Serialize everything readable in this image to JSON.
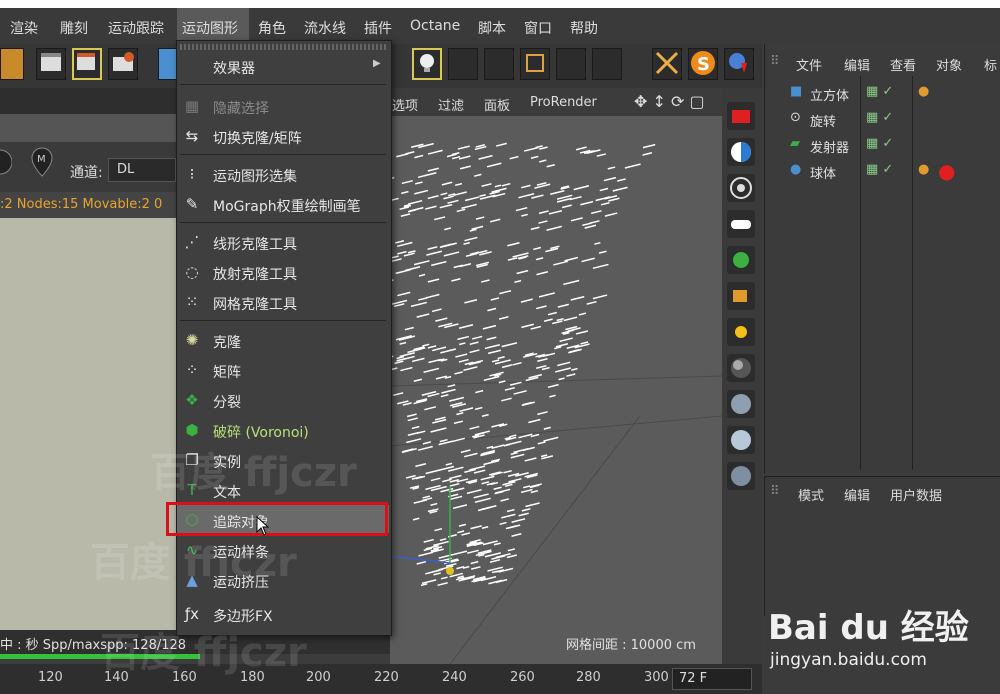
{
  "menubar": {
    "items": [
      "渲染",
      "雕刻",
      "运动跟踪",
      "运动图形",
      "角色",
      "流水线",
      "插件",
      "Octane",
      "脚本",
      "窗口",
      "帮助"
    ]
  },
  "leftpanel": {
    "channel_label": "通道:",
    "channel_value": "DL",
    "info_text": ":2 Nodes:15 Movable:2  0"
  },
  "viewport": {
    "menus": [
      "选项",
      "过滤",
      "面板",
      "ProRender"
    ],
    "grid_readout": "网格间距 : 10000 cm"
  },
  "object_manager": {
    "menus": [
      "文件",
      "编辑",
      "查看",
      "对象",
      "标"
    ],
    "objects": [
      "立方体",
      "旋转",
      "发射器",
      "球体"
    ]
  },
  "attribute_manager": {
    "menus": [
      "模式",
      "编辑",
      "用户数据"
    ]
  },
  "dropdown": {
    "items": [
      {
        "label": "效果器",
        "icon": "submenu-arrow-icon",
        "state": "normal"
      },
      {
        "label": "隐藏选择",
        "icon": "hide-selection-icon",
        "state": "dim"
      },
      {
        "label": "切换克隆/矩阵",
        "icon": "toggle-clone-icon",
        "state": "normal"
      },
      {
        "label": "运动图形选集",
        "icon": "mograph-selection-icon",
        "state": "normal"
      },
      {
        "label": "MoGraph权重绘制画笔",
        "icon": "weight-brush-icon",
        "state": "normal"
      },
      {
        "label": "线形克隆工具",
        "icon": "linear-clone-icon",
        "state": "normal"
      },
      {
        "label": "放射克隆工具",
        "icon": "radial-clone-icon",
        "state": "normal"
      },
      {
        "label": "网格克隆工具",
        "icon": "grid-clone-icon",
        "state": "normal"
      },
      {
        "label": "克隆",
        "icon": "cloner-icon",
        "state": "normal"
      },
      {
        "label": "矩阵",
        "icon": "matrix-icon",
        "state": "normal"
      },
      {
        "label": "分裂",
        "icon": "fracture-icon",
        "state": "normal"
      },
      {
        "label": "破碎 (Voronoi)",
        "icon": "voronoi-icon",
        "state": "green"
      },
      {
        "label": "实例",
        "icon": "instance-icon",
        "state": "normal"
      },
      {
        "label": "文本",
        "icon": "text-icon",
        "state": "normal"
      },
      {
        "label": "追踪对象",
        "icon": "tracer-icon",
        "state": "highlighted"
      },
      {
        "label": "运动样条",
        "icon": "mospline-icon",
        "state": "normal"
      },
      {
        "label": "运动挤压",
        "icon": "moextrude-icon",
        "state": "normal"
      },
      {
        "label": "多边形FX",
        "icon": "polyfx-icon",
        "state": "normal"
      }
    ]
  },
  "statusbar": {
    "text": "中 : 秒  Spp/maxspp: 128/128"
  },
  "timeline": {
    "ticks": [
      "120",
      "140",
      "160",
      "180",
      "200",
      "220",
      "240",
      "260",
      "280",
      "300"
    ],
    "frame_field": "72 F"
  },
  "watermarks": {
    "baidu_mark": "Bai du 经验",
    "baidu_url": "jingyan.baidu.com",
    "overlay": "百度 ffjczr"
  },
  "colors": {
    "highlight_red": "#d8101a",
    "accent_green": "#35c23a",
    "menu_bg": "#3f3f3f"
  }
}
